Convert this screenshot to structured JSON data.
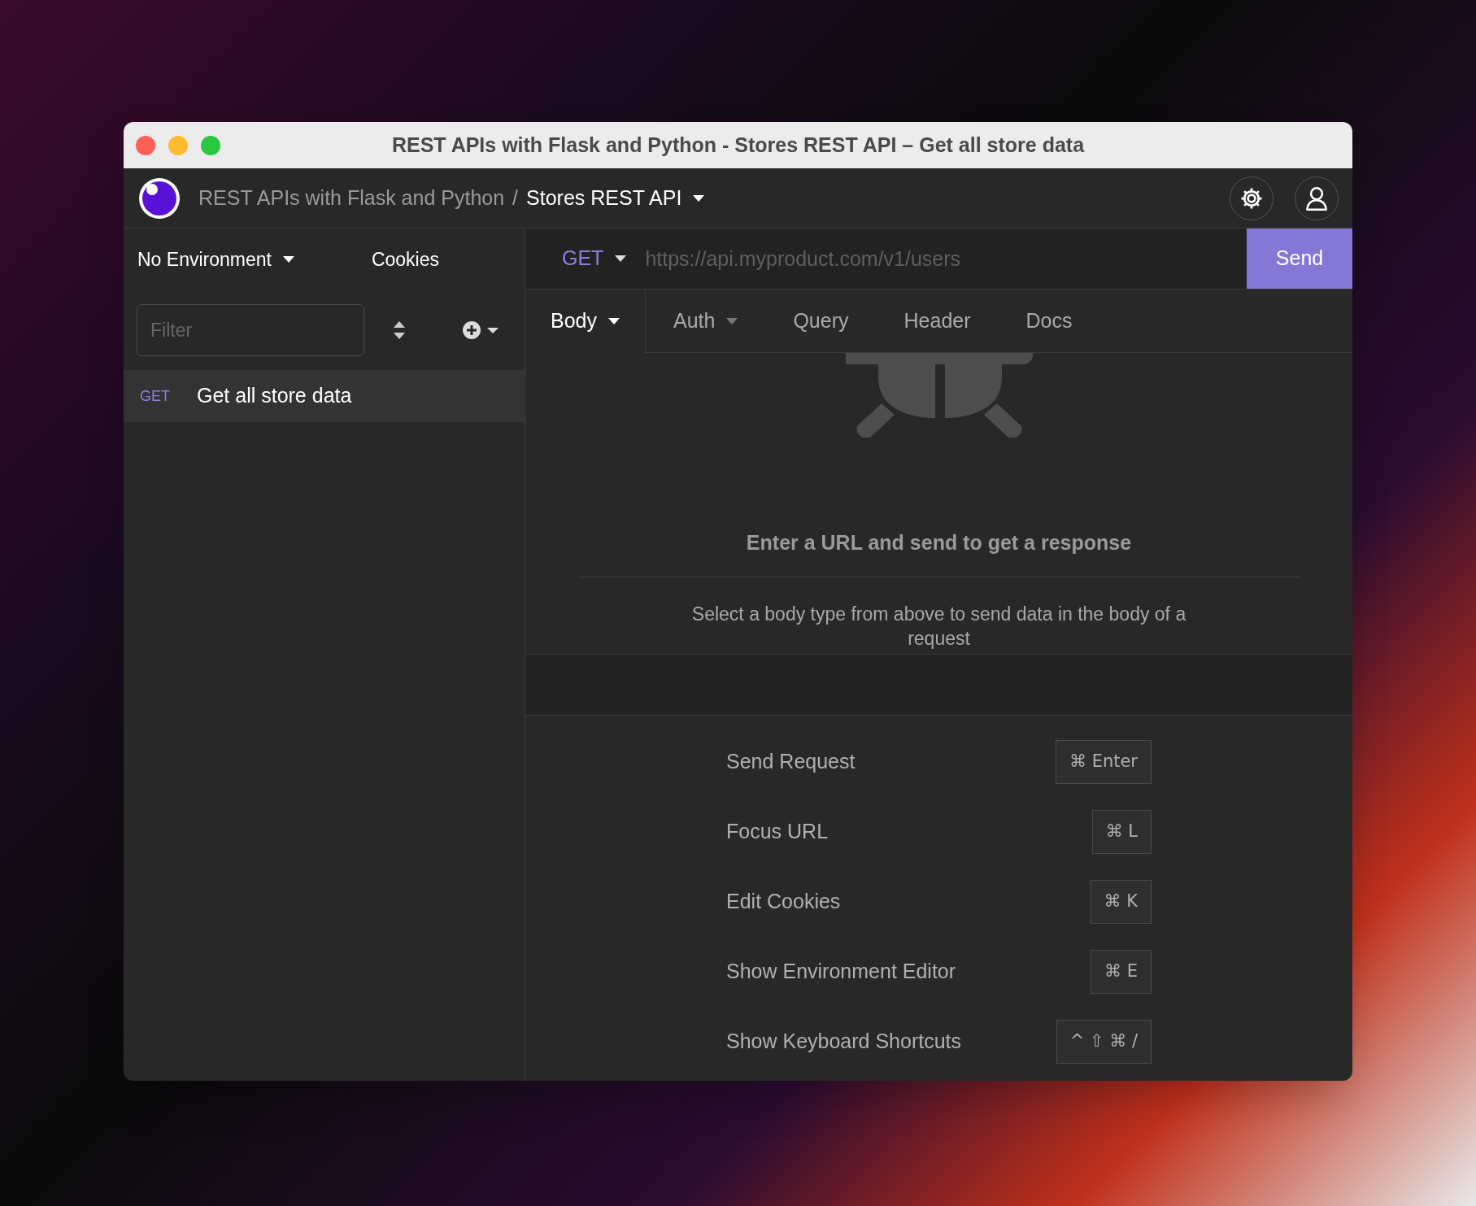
{
  "window": {
    "title": "REST APIs with Flask and Python - Stores REST API – Get all store data"
  },
  "header": {
    "workspace": "REST APIs with Flask and Python",
    "separator": "/",
    "collection": "Stores REST API"
  },
  "sidebar": {
    "environment": "No Environment",
    "cookies": "Cookies",
    "filter": {
      "placeholder": "Filter"
    },
    "requests": [
      {
        "method": "GET",
        "name": "Get all store data",
        "selected": true
      }
    ]
  },
  "request": {
    "method": "GET",
    "url": {
      "placeholder": "https://api.myproduct.com/v1/users"
    },
    "send": "Send",
    "tabs": [
      {
        "label": "Body",
        "selected": true,
        "caret": true
      },
      {
        "label": "Auth",
        "selected": false,
        "caret": true
      },
      {
        "label": "Query",
        "selected": false,
        "caret": false
      },
      {
        "label": "Header",
        "selected": false,
        "caret": false
      },
      {
        "label": "Docs",
        "selected": false,
        "caret": false
      }
    ]
  },
  "response": {
    "message": "Enter a URL and send to get a response"
  },
  "body": {
    "hint": "Select a body type from above to send data in the body of a request"
  },
  "shortcuts": [
    {
      "label": "Send Request",
      "keys": "⌘ Enter"
    },
    {
      "label": "Focus URL",
      "keys": "⌘ L"
    },
    {
      "label": "Edit Cookies",
      "keys": "⌘ K"
    },
    {
      "label": "Show Environment Editor",
      "keys": "⌘ E"
    },
    {
      "label": "Show Keyboard Shortcuts",
      "keys": "^ ⇧ ⌘ /"
    }
  ]
}
